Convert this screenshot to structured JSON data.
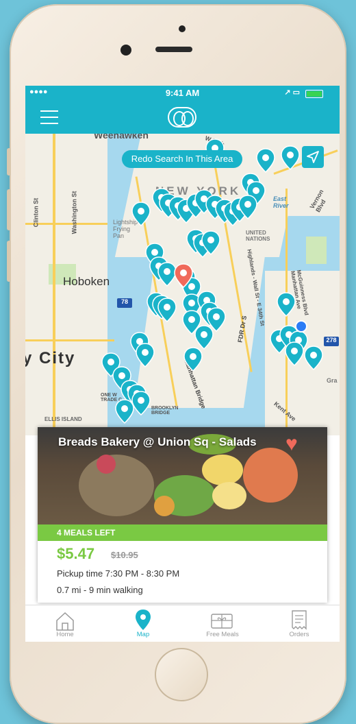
{
  "status_bar": {
    "time": "9:41 AM",
    "signal": "●●●●",
    "right_icons": "↗ ▭"
  },
  "nav": {
    "menu_icon": "hamburger-icon",
    "logo": "app-logo"
  },
  "map": {
    "redo_button": "Redo Search In This Area",
    "labels": {
      "weehawken": "Weehawken",
      "hoboken": "Hoboken",
      "city": "y City",
      "new_york": "NEW YORK",
      "lights_frying_pan": "Lightship Frying Pan",
      "united_nations": "UNITED NATIONS",
      "east_river": "East River",
      "fdr": "FDR Dr S",
      "ellis_island": "ELLIS ISLAND",
      "brooklyn_bridge": "BROOKLYN BRIDGE",
      "manhattan_bridge": "Manhattan Bridge",
      "hwy_78": "78",
      "hwy_278": "278",
      "one_world": "ONE W\nTRADE C",
      "washington": "Washington St",
      "clinton": "Clinton St",
      "highlands": "Highlands - Wall St - E 34th St",
      "vernon": "Vernon Blvd",
      "mcguinness": "McGuinness Blvd\nManhattan Ave",
      "kent": "Kent Ave",
      "w57": "W 57th",
      "gra": "Gra"
    },
    "colors": {
      "pin": "#1ab3c9",
      "selected_pin": "#f06a5b",
      "user_location": "#2b7cf6"
    }
  },
  "card": {
    "title": "Breads Bakery @ Union Sq - Salads",
    "favorite_icon": "heart-icon",
    "meals_left": "4 MEALS LEFT",
    "price": "$5.47",
    "original_price": "$10.95",
    "pickup_time": "Pickup time  7:30 PM -  8:30 PM",
    "distance": "0.7 mi - 9 min walking"
  },
  "tabs": [
    {
      "label": "Home",
      "icon": "home-icon"
    },
    {
      "label": "Map",
      "icon": "map-pin-icon"
    },
    {
      "label": "Free Meals",
      "icon": "gift-card-icon"
    },
    {
      "label": "Orders",
      "icon": "receipt-icon"
    }
  ],
  "accent": "#1ab3c9",
  "green": "#7ac943"
}
